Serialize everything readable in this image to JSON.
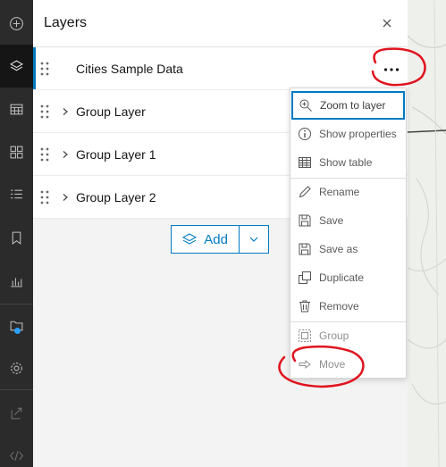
{
  "panel": {
    "title": "Layers",
    "close_icon": "close-icon"
  },
  "layers": [
    {
      "label": "Cities Sample Data",
      "selected": true,
      "expandable": false
    },
    {
      "label": "Group Layer",
      "selected": false,
      "expandable": true
    },
    {
      "label": "Group Layer 1",
      "selected": false,
      "expandable": true
    },
    {
      "label": "Group Layer 2",
      "selected": false,
      "expandable": true
    }
  ],
  "add_button": {
    "label": "Add",
    "icon": "layers-add-icon"
  },
  "menu": {
    "items": [
      {
        "label": "Zoom to layer",
        "icon": "zoom-in-icon",
        "state": "focused"
      },
      {
        "label": "Show properties",
        "icon": "info-icon",
        "state": "normal"
      },
      {
        "label": "Show table",
        "icon": "table-icon",
        "state": "normal"
      },
      {
        "label": "Rename",
        "icon": "pencil-icon",
        "state": "normal"
      },
      {
        "label": "Save",
        "icon": "save-icon",
        "state": "normal"
      },
      {
        "label": "Save as",
        "icon": "save-as-icon",
        "state": "normal"
      },
      {
        "label": "Duplicate",
        "icon": "duplicate-icon",
        "state": "normal"
      },
      {
        "label": "Remove",
        "icon": "trash-icon",
        "state": "normal"
      },
      {
        "label": "Group",
        "icon": "group-icon",
        "state": "disabled"
      },
      {
        "label": "Move",
        "icon": "move-arrow-icon",
        "state": "disabled"
      }
    ]
  },
  "rail": [
    {
      "icon": "add-circle-icon"
    },
    {
      "icon": "layers-icon",
      "active": true
    },
    {
      "icon": "table-icon"
    },
    {
      "icon": "basemap-gallery-icon"
    },
    {
      "icon": "legend-list-icon"
    },
    {
      "icon": "bookmark-icon"
    },
    {
      "icon": "chart-icon"
    },
    {
      "icon": "folder-icon"
    },
    {
      "icon": "gear-icon"
    },
    {
      "icon": "share-icon"
    },
    {
      "icon": "embed-code-icon"
    }
  ],
  "colors": {
    "accent": "#007ac2",
    "annotation": "#e0141e",
    "rail": "#2b2b2b"
  }
}
